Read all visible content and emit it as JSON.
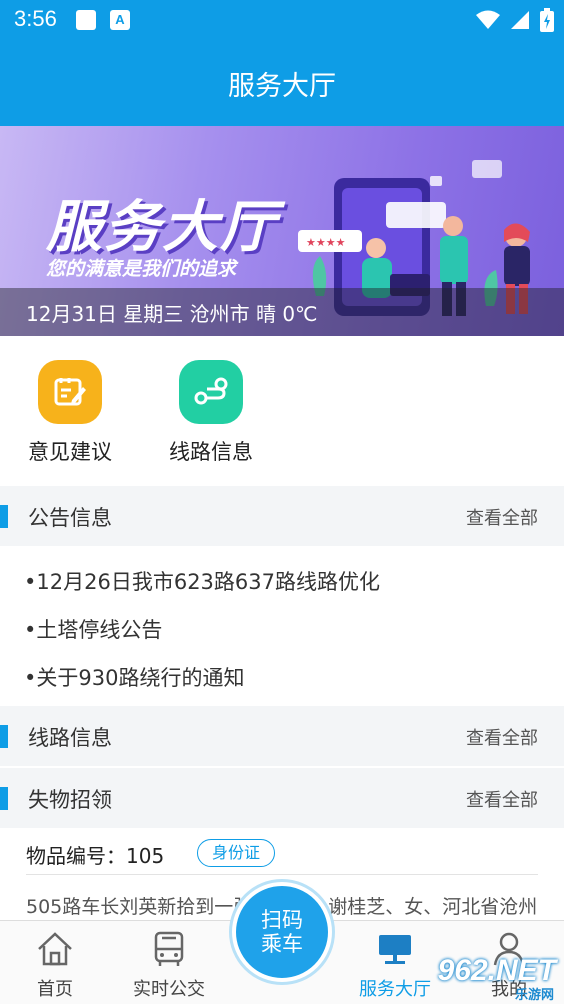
{
  "status_bar": {
    "time": "3:56",
    "a_label": "A"
  },
  "app_bar": {
    "title": "服务大厅"
  },
  "banner": {
    "title": "服务大厅",
    "subtitle": "您的满意是我们的追求",
    "info": "12月31日 星期三 沧州市 晴 0℃"
  },
  "quick_actions": [
    {
      "label": "意见建议",
      "icon": "edit-note-icon",
      "color": "#f7b21b"
    },
    {
      "label": "线路信息",
      "icon": "route-icon",
      "color": "#22cfa3"
    }
  ],
  "sections": {
    "notices": {
      "title": "公告信息",
      "more": "查看全部"
    },
    "routes": {
      "title": "线路信息",
      "more": "查看全部"
    },
    "lost_found": {
      "title": "失物招领",
      "more": "查看全部"
    }
  },
  "notices": [
    "•12月26日我市623路637路线路优化",
    "•土塔停线公告",
    "•关于930路绕行的通知"
  ],
  "lost_item": {
    "code_label": "物品编号：105",
    "tag": "身份证",
    "description": "505路车长刘英新拾到一张身份证，谢桂芝、女、河北省沧州"
  },
  "bottom_nav": {
    "home": "首页",
    "realtime": "实时公交",
    "scan_line1": "扫码",
    "scan_line2": "乘车",
    "service": "服务大厅",
    "mine": "我的"
  },
  "watermark": {
    "text": "962.NET",
    "sub": "乐游网"
  },
  "colors": {
    "primary": "#0e9de6",
    "accent_yellow": "#f7b21b",
    "accent_green": "#22cfa3"
  }
}
